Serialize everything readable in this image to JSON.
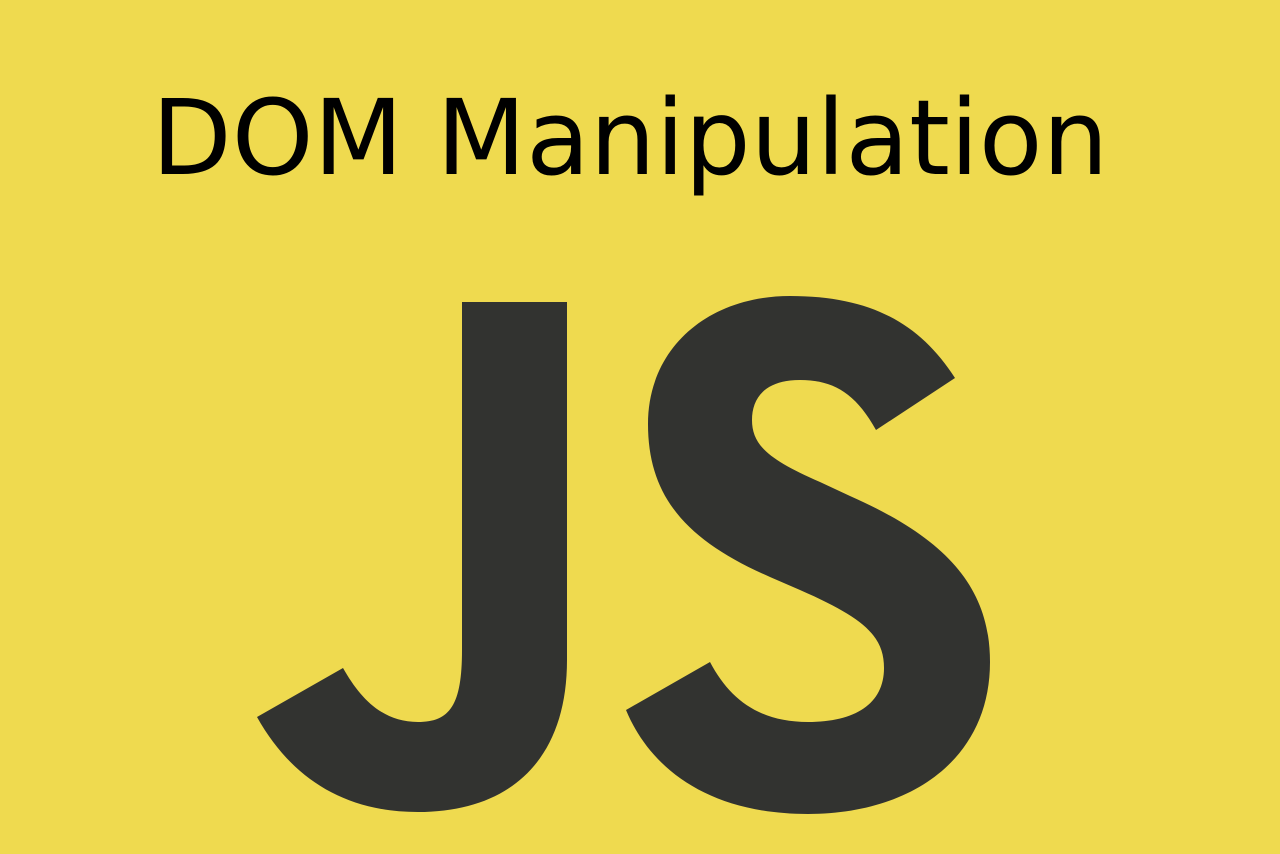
{
  "title": "DOM Manipulation",
  "logo": {
    "text": "JS",
    "name": "javascript-logo",
    "color": "#323330"
  },
  "colors": {
    "background": "#EFDA4F",
    "title_text": "#000000"
  }
}
